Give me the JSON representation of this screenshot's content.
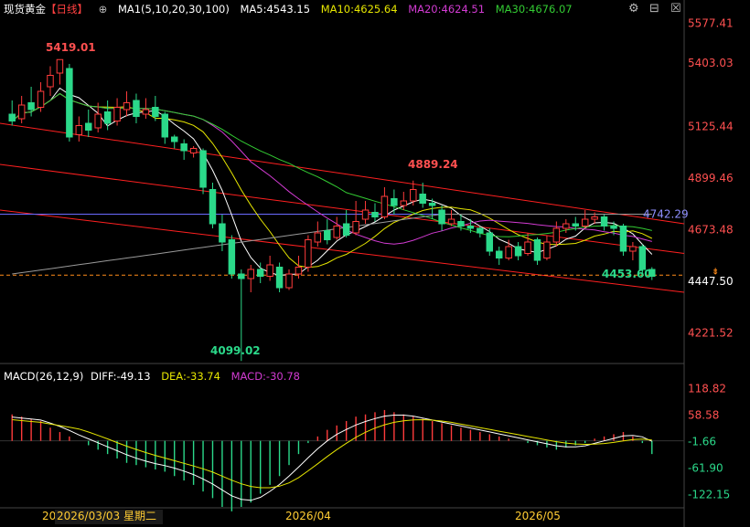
{
  "header": {
    "symbol": "现货黄金",
    "period": "【日线】",
    "ma_title": "MA1(5,10,20,30,100)",
    "ma5": "MA5:4543.15",
    "ma10": "MA10:4625.64",
    "ma20": "MA20:4624.51",
    "ma30": "MA30:4676.07"
  },
  "macd_header": {
    "title": "MACD(26,12,9)",
    "diff": "DIFF:-49.13",
    "dea": "DEA:-33.74",
    "macd": "MACD:-30.78"
  },
  "toolbar": {
    "settings_icon": "gear-icon",
    "minimize_icon": "minus-icon",
    "close_icon": "close-icon"
  },
  "price_axis": [
    "5577.41",
    "5403.03",
    "5125.44",
    "4899.46",
    "4673.48",
    "4447.50",
    "4221.52"
  ],
  "macd_axis": [
    "118.82",
    "58.58",
    "-1.66",
    "-61.90",
    "-122.15"
  ],
  "date_axis": {
    "start": "20",
    "cursor_date": "2026/03/03 星期二",
    "m1": "2026/04",
    "m2": "2026/05"
  },
  "annotations": {
    "high": "5419.01",
    "low": "4099.02",
    "mid_high": "4889.24",
    "ma100_label": "4742.29",
    "last_low": "4453.60",
    "current_price": "4447.50"
  },
  "colors": {
    "up": "#ff3b3b",
    "down": "#2bd98a",
    "ma5": "#ffffff",
    "ma10": "#e6e600",
    "ma20": "#d23bd2",
    "ma30": "#33cc33",
    "ma100": "#9a9a9a",
    "trend": "#ff2020",
    "hline": "#6a6aff",
    "dashed": "#ff8c1a"
  },
  "chart_data": {
    "type": "candlestick",
    "title": "现货黄金 日线",
    "candles": [
      [
        5180,
        5150,
        5240,
        5130
      ],
      [
        5160,
        5220,
        5260,
        5140
      ],
      [
        5230,
        5200,
        5300,
        5170
      ],
      [
        5210,
        5280,
        5320,
        5190
      ],
      [
        5300,
        5350,
        5390,
        5260
      ],
      [
        5360,
        5419,
        5419,
        5310
      ],
      [
        5380,
        5080,
        5400,
        5060
      ],
      [
        5090,
        5130,
        5170,
        5060
      ],
      [
        5140,
        5110,
        5200,
        5080
      ],
      [
        5120,
        5180,
        5230,
        5100
      ],
      [
        5190,
        5140,
        5240,
        5110
      ],
      [
        5150,
        5210,
        5250,
        5130
      ],
      [
        5200,
        5230,
        5280,
        5170
      ],
      [
        5240,
        5170,
        5270,
        5140
      ],
      [
        5180,
        5200,
        5250,
        5160
      ],
      [
        5210,
        5170,
        5260,
        5150
      ],
      [
        5180,
        5080,
        5190,
        5050
      ],
      [
        5080,
        5060,
        5090,
        5030
      ],
      [
        5050,
        5020,
        5070,
        4980
      ],
      [
        5010,
        5030,
        5040,
        4990
      ],
      [
        5020,
        4860,
        5030,
        4830
      ],
      [
        4850,
        4700,
        4880,
        4680
      ],
      [
        4700,
        4620,
        4740,
        4580
      ],
      [
        4630,
        4480,
        4650,
        4460
      ],
      [
        4480,
        4460,
        4500,
        4099
      ],
      [
        4460,
        4500,
        4520,
        4400
      ],
      [
        4500,
        4470,
        4530,
        4440
      ],
      [
        4470,
        4520,
        4560,
        4450
      ],
      [
        4510,
        4420,
        4530,
        4400
      ],
      [
        4420,
        4480,
        4500,
        4410
      ],
      [
        4480,
        4510,
        4560,
        4460
      ],
      [
        4510,
        4630,
        4650,
        4490
      ],
      [
        4620,
        4660,
        4710,
        4600
      ],
      [
        4670,
        4630,
        4720,
        4610
      ],
      [
        4640,
        4690,
        4730,
        4630
      ],
      [
        4700,
        4650,
        4760,
        4640
      ],
      [
        4660,
        4710,
        4800,
        4650
      ],
      [
        4720,
        4760,
        4800,
        4700
      ],
      [
        4750,
        4730,
        4790,
        4710
      ],
      [
        4730,
        4820,
        4860,
        4720
      ],
      [
        4810,
        4780,
        4850,
        4740
      ],
      [
        4780,
        4800,
        4840,
        4760
      ],
      [
        4800,
        4850,
        4889,
        4780
      ],
      [
        4830,
        4790,
        4880,
        4770
      ],
      [
        4790,
        4780,
        4810,
        4720
      ],
      [
        4760,
        4700,
        4780,
        4670
      ],
      [
        4700,
        4720,
        4760,
        4690
      ],
      [
        4710,
        4690,
        4740,
        4670
      ],
      [
        4690,
        4680,
        4720,
        4660
      ],
      [
        4680,
        4660,
        4690,
        4640
      ],
      [
        4660,
        4580,
        4680,
        4560
      ],
      [
        4580,
        4550,
        4600,
        4520
      ],
      [
        4550,
        4600,
        4630,
        4540
      ],
      [
        4600,
        4560,
        4620,
        4540
      ],
      [
        4570,
        4620,
        4660,
        4560
      ],
      [
        4630,
        4540,
        4640,
        4520
      ],
      [
        4550,
        4620,
        4650,
        4540
      ],
      [
        4620,
        4680,
        4710,
        4600
      ],
      [
        4680,
        4700,
        4720,
        4660
      ],
      [
        4700,
        4690,
        4730,
        4670
      ],
      [
        4690,
        4720,
        4760,
        4680
      ],
      [
        4720,
        4730,
        4750,
        4700
      ],
      [
        4730,
        4690,
        4740,
        4670
      ],
      [
        4690,
        4680,
        4710,
        4650
      ],
      [
        4690,
        4580,
        4700,
        4560
      ],
      [
        4580,
        4600,
        4620,
        4540
      ],
      [
        4600,
        4500,
        4610,
        4470
      ],
      [
        4500,
        4470,
        4510,
        4453.6
      ]
    ],
    "macd_histogram": [
      60,
      55,
      50,
      45,
      30,
      20,
      10,
      0,
      -10,
      -20,
      -30,
      -40,
      -50,
      -55,
      -60,
      -65,
      -70,
      -80,
      -90,
      -100,
      -115,
      -130,
      -150,
      -160,
      -150,
      -140,
      -120,
      -100,
      -80,
      -55,
      -30,
      -5,
      10,
      25,
      35,
      45,
      55,
      60,
      65,
      70,
      65,
      60,
      55,
      50,
      45,
      40,
      35,
      30,
      25,
      20,
      15,
      10,
      5,
      0,
      -5,
      -10,
      -15,
      -20,
      -15,
      -10,
      -5,
      5,
      10,
      15,
      20,
      10,
      -5,
      -30
    ],
    "ylim_price": [
      4100,
      5600
    ],
    "ylim_macd": [
      -150,
      130
    ]
  }
}
